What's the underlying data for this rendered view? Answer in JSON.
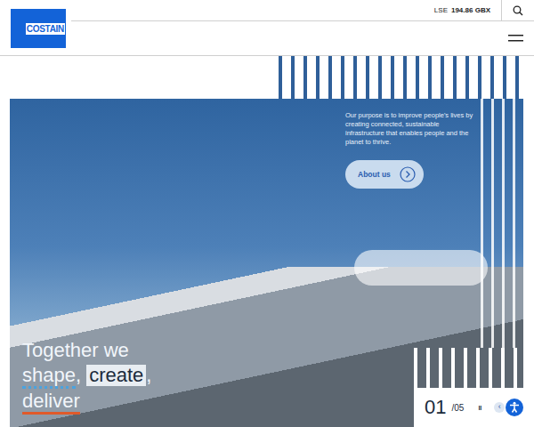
{
  "logo": "COSTAIN",
  "stock": {
    "label": "LSE",
    "value": "194.86 GBX"
  },
  "hero": {
    "purpose": "Our purpose is to improve people's lives by creating connected, sustainable infrastructure that enables people and the planet to thrive.",
    "cta": "About us",
    "headline_first": "Together we",
    "headline_words": [
      {
        "text": "shape",
        "kind": "dotted",
        "sep": ","
      },
      {
        "text": "create",
        "kind": "highlight",
        "sep": ","
      },
      {
        "text": "deliver",
        "kind": "underline",
        "sep": ""
      }
    ]
  },
  "slider": {
    "current": "01",
    "total": "/05",
    "pause": "II",
    "prev": "‹"
  }
}
